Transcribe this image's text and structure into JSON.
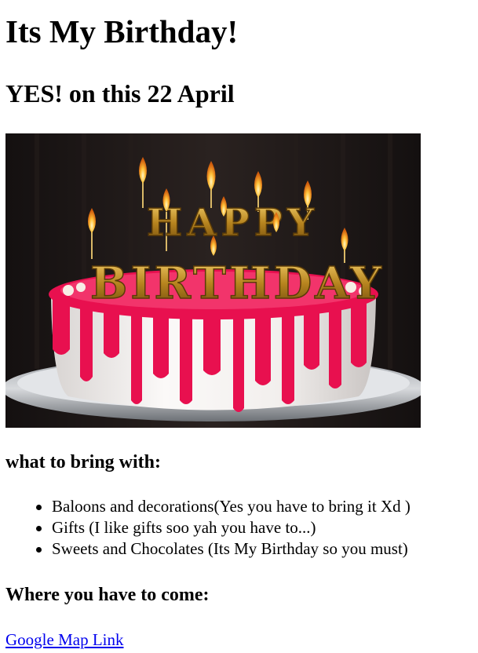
{
  "header": {
    "title": "Its My Birthday!",
    "subtitle": "YES! on this 22 April"
  },
  "image": {
    "description_icon": "birthday-cake-photo",
    "candle_letters": "HAPPY BIRTHDAY"
  },
  "bring": {
    "heading": "what to bring with:",
    "items": [
      "Baloons and decorations(Yes you have to bring it Xd )",
      "Gifts (I like gifts soo yah you have to...)",
      "Sweets and Chocolates (Its My Birthday so you must)"
    ]
  },
  "location": {
    "heading": "Where you have to come:",
    "link_label": "Google Map Link"
  },
  "colors": {
    "link": "#0000ee",
    "icing": "#e8104f",
    "cake": "#f4f1ee",
    "background_photo": "#1a1616"
  }
}
